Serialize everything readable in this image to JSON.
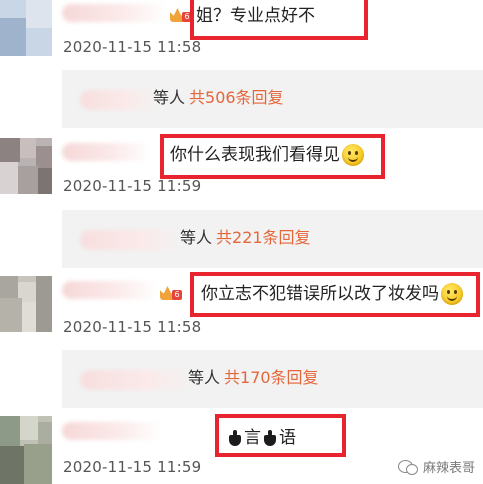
{
  "comments": [
    {
      "text": "姐？专业点好不",
      "timestamp": "2020-11-15 11:58",
      "reply_suffix": "等人",
      "reply_count": "共506条回复",
      "level_badge": "6"
    },
    {
      "text": "你什么表现我们看得见",
      "timestamp": "2020-11-15 11:59",
      "reply_suffix": "等人",
      "reply_count": "共221条回复"
    },
    {
      "text": "你立志不犯错误所以改了妆发吗",
      "timestamp": "2020-11-15 11:58",
      "reply_suffix": "等人",
      "reply_count": "共170条回复",
      "level_badge": "6"
    },
    {
      "text_char1": "言",
      "text_char2": "语",
      "timestamp": "2020-11-15 11:59"
    }
  ],
  "watermark": "麻辣表哥",
  "colors": {
    "highlight_border": "#e8252e",
    "reply_count": "#e5663a",
    "reply_background": "#f2f2f2"
  },
  "icons": [
    "smiley-emoji-icon",
    "crown-level-badge-icon",
    "pot-emoji-icon",
    "wechat-logo-icon"
  ]
}
